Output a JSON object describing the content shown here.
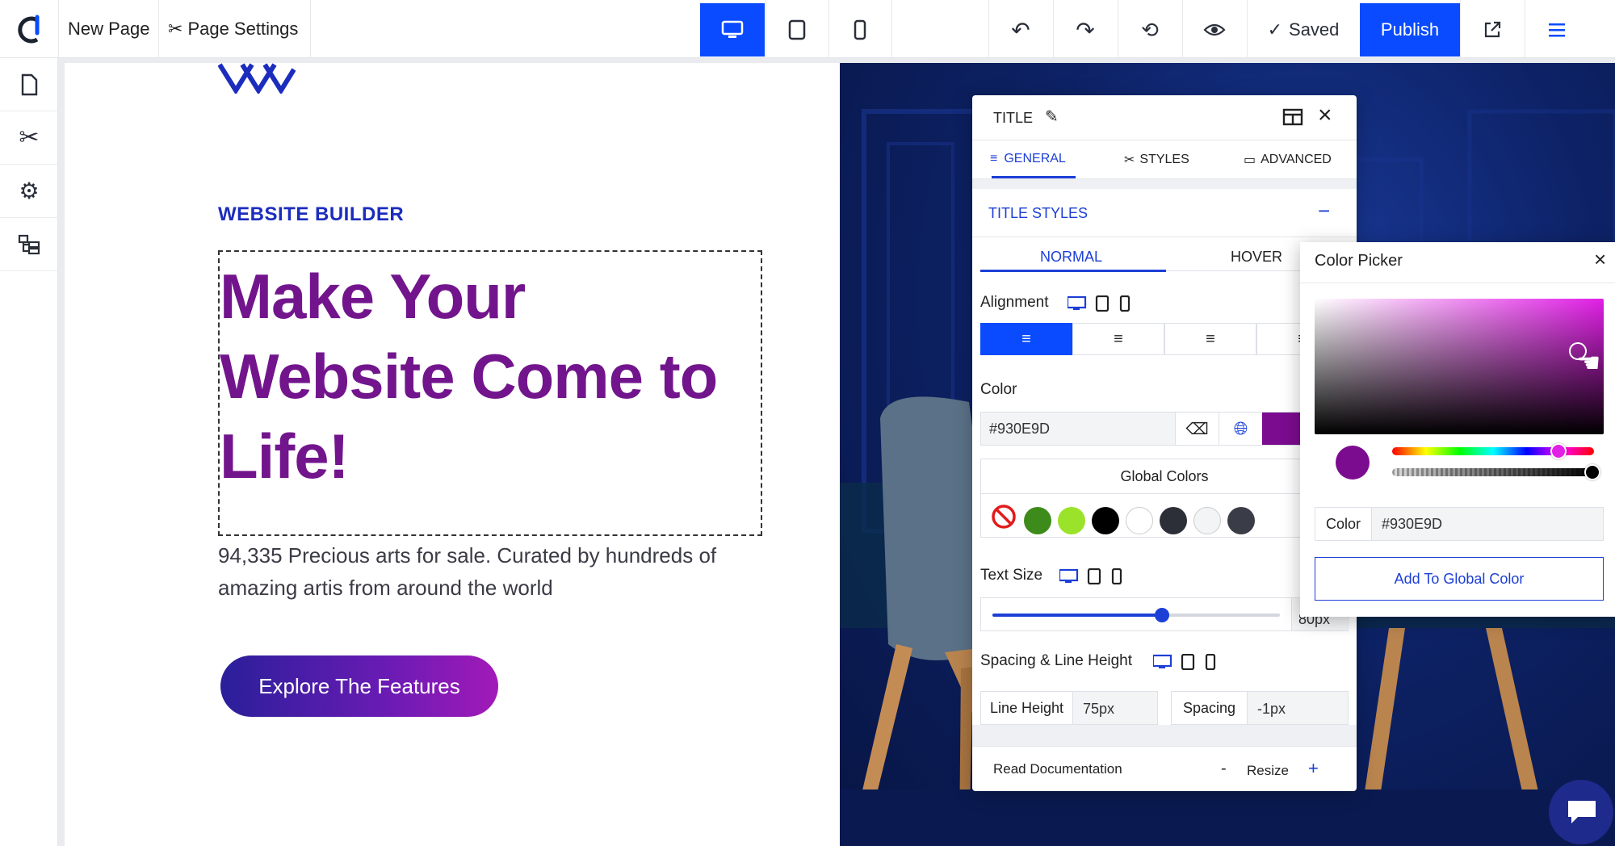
{
  "topbar": {
    "page_name": "New Page",
    "page_settings": "Page Settings",
    "saved": "Saved",
    "publish": "Publish"
  },
  "hero": {
    "kicker": "WEBSITE BUILDER",
    "title": "Make Your Website Come to Life!",
    "description": "94,335 Precious arts for sale. Curated by hundreds of amazing artis from around the world",
    "cta": "Explore The Features"
  },
  "panel": {
    "title": "TITLE",
    "tabs": [
      "GENERAL",
      "STYLES",
      "ADVANCED"
    ],
    "section": "TITLE STYLES",
    "state_tabs": [
      "NORMAL",
      "HOVER"
    ],
    "alignment_label": "Alignment",
    "color_label": "Color",
    "color_value": "#930E9D",
    "global_colors_label": "Global Colors",
    "global_swatches": [
      "#3d8b1a",
      "#9be22a",
      "#000000",
      "#ffffff",
      "#2c2f38",
      "#f3f4f6",
      "#3a3d47"
    ],
    "text_size_label": "Text Size",
    "text_size_value": "80px",
    "text_size_level": 0.59,
    "spacing_label": "Spacing & Line Height",
    "line_height_label": "Line Height",
    "line_height_value": "75px",
    "spacing_field_label": "Spacing",
    "spacing_value": "-1px",
    "footer_doc": "Read Documentation",
    "footer_minus": "-",
    "footer_resize": "Resize",
    "footer_plus": "+"
  },
  "picker": {
    "title": "Color Picker",
    "close": "×",
    "color_label": "Color",
    "color_value": "#930E9D",
    "add_global": "Add To Global Color"
  },
  "colors": {
    "accent_blue": "#0a4bff",
    "title_purple": "#72158d",
    "picked": "#7b0b8f"
  }
}
